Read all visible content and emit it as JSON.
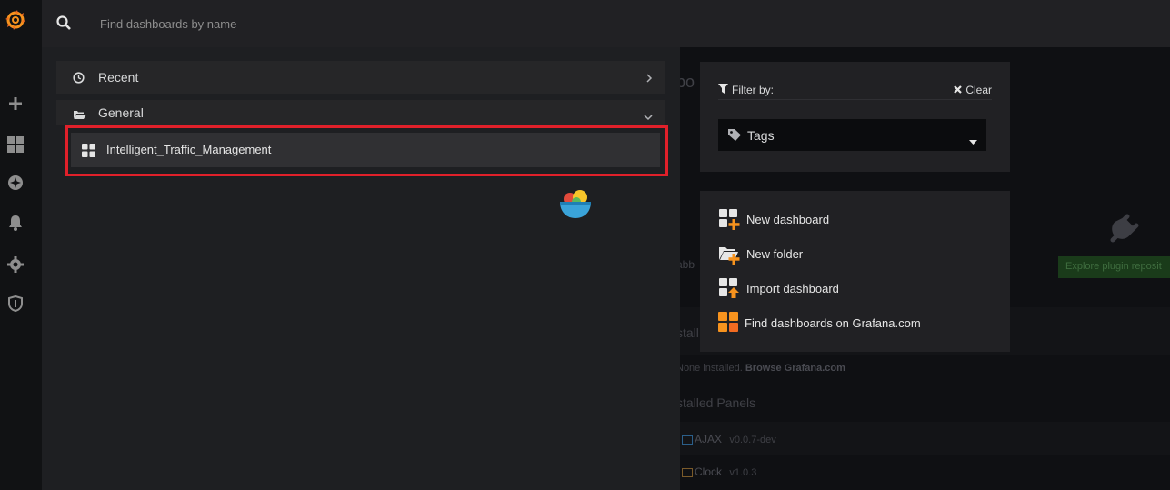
{
  "search": {
    "placeholder": "Find dashboards by name"
  },
  "sidebar": {
    "items": [
      {
        "name": "grafana-logo"
      },
      {
        "name": "create-icon"
      },
      {
        "name": "dashboards-icon"
      },
      {
        "name": "explore-icon"
      },
      {
        "name": "alerting-icon"
      },
      {
        "name": "configuration-icon"
      },
      {
        "name": "server-admin-icon"
      }
    ]
  },
  "results": {
    "sections": [
      {
        "label": "Recent",
        "icon": "clock-icon",
        "chevron": "chevron-right-icon"
      },
      {
        "label": "General",
        "icon": "folder-open-icon",
        "chevron": "chevron-down-icon"
      }
    ],
    "dashboards": [
      {
        "label": "Intelligent_Traffic_Management",
        "icon": "dashboard-grid-icon"
      }
    ]
  },
  "filter": {
    "label": "Filter by:",
    "clear_label": "Clear",
    "tags_label": "Tags"
  },
  "actions": [
    {
      "label": "New dashboard",
      "icon": "new-dashboard-icon"
    },
    {
      "label": "New folder",
      "icon": "new-folder-icon"
    },
    {
      "label": "Import dashboard",
      "icon": "import-dashboard-icon"
    },
    {
      "label": "Find dashboards on Grafana.com",
      "icon": "grafana-com-icon"
    }
  ],
  "background": {
    "title_fragment": "bo",
    "dashboards_fragment": "abb",
    "installed_fragment": "stall",
    "none_installed": "None installed.",
    "browse_link": "Browse Grafana.com",
    "installed_panels": "stalled Panels",
    "panels": [
      {
        "name": "AJAX",
        "version": "v0.0.7-dev"
      },
      {
        "name": "Clock",
        "version": "v1.0.3"
      }
    ],
    "plugin_button": "Explore plugin reposit"
  },
  "colors": {
    "accent_orange": "#f7931e",
    "highlight_red": "#e0202a",
    "sidebar_bg": "#111214"
  }
}
